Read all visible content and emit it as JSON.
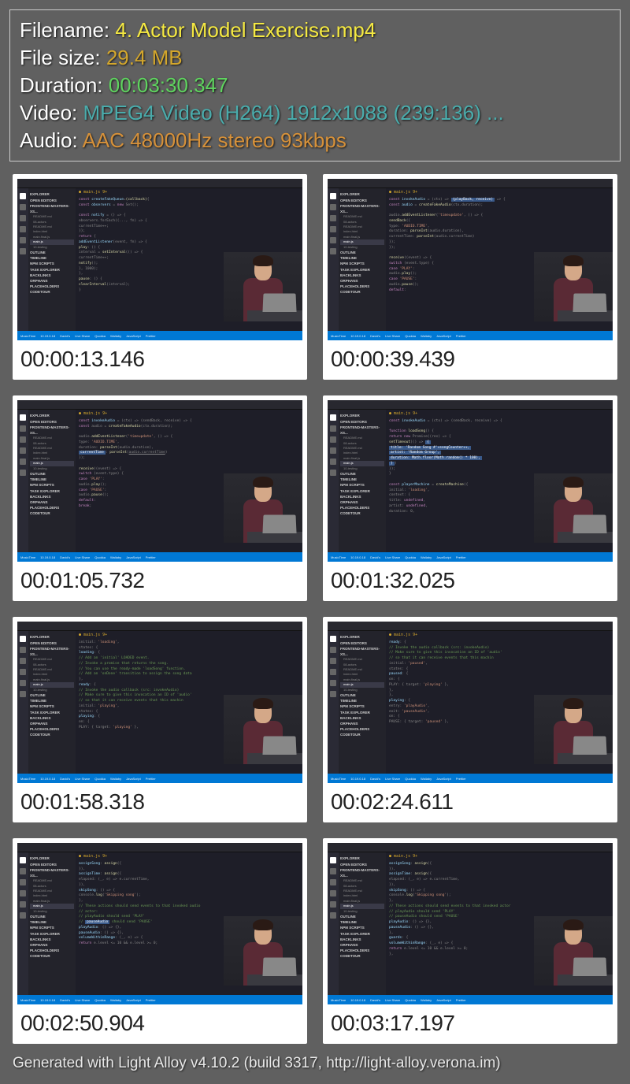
{
  "info": {
    "filename_label": "Filename: ",
    "filename_value": "4. Actor Model Exercise.mp4",
    "filesize_label": "File size: ",
    "filesize_value": "29.4 MB",
    "duration_label": "Duration: ",
    "duration_value": "00:03:30.347",
    "video_label": "Video: ",
    "video_value": "MPEG4 Video (H264) 1912x1088 (239:136) ...",
    "audio_label": "Audio: ",
    "audio_value": "AAC 48000Hz stereo 93kbps"
  },
  "thumbnails": [
    {
      "timestamp": "00:00:13.146"
    },
    {
      "timestamp": "00:00:39.439"
    },
    {
      "timestamp": "00:01:05.732"
    },
    {
      "timestamp": "00:01:32.025"
    },
    {
      "timestamp": "00:01:58.318"
    },
    {
      "timestamp": "00:02:24.611"
    },
    {
      "timestamp": "00:02:50.904"
    },
    {
      "timestamp": "00:03:17.197"
    }
  ],
  "editor": {
    "tab": "main.js 9+",
    "sidebar": {
      "explorer": "EXPLORER",
      "open_editors": "OPEN EDITORS",
      "workspace": "FRONTEND-MASTERS-XS...",
      "items": [
        "README.md",
        "08-actors",
        "README.md",
        "index.html",
        "main.final.js",
        "main.js",
        "10-testing"
      ],
      "sections": [
        "OUTLINE",
        "TIMELINE",
        "NPM SCRIPTS",
        "TASK EXPLORER",
        "BACKLINKS",
        "ORPHANS",
        "PLACEHOLDERS",
        "CODETOUR"
      ]
    },
    "status": [
      "MusicTime",
      "10.19.0.18",
      "David's",
      "Live Share",
      "Quokka",
      "Wallaby",
      "JavaScript",
      "Prettier"
    ]
  },
  "footer": "Generated with Light Alloy v4.10.2 (build 3317, http://light-alloy.verona.im)"
}
